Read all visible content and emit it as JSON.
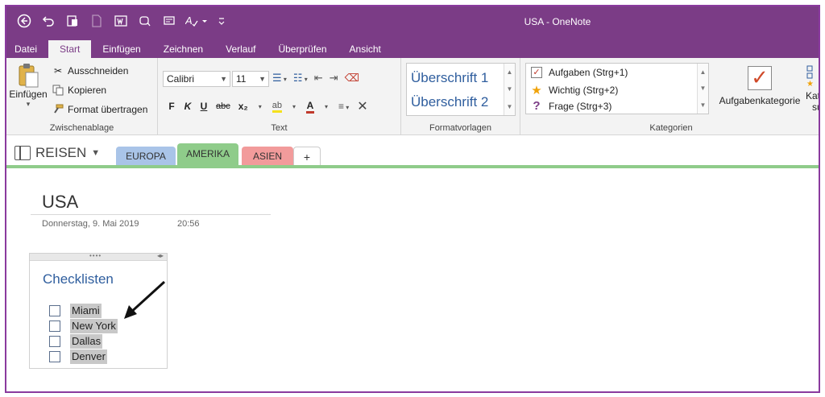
{
  "window": {
    "title": "USA - OneNote"
  },
  "menu": {
    "tabs": [
      "Datei",
      "Start",
      "Einfügen",
      "Zeichnen",
      "Verlauf",
      "Überprüfen",
      "Ansicht"
    ]
  },
  "ribbon": {
    "clipboard": {
      "paste": "Einfügen",
      "cut": "Ausschneiden",
      "copy": "Kopieren",
      "format_painter": "Format übertragen",
      "label": "Zwischenablage"
    },
    "text": {
      "font": "Calibri",
      "size": "11",
      "bold": "F",
      "italic": "K",
      "underline": "U",
      "strike": "abc",
      "subscript": "x₂",
      "font_color": "A",
      "label": "Text"
    },
    "styles": {
      "items": [
        "Überschrift 1",
        "Überschrift 2"
      ],
      "label": "Formatvorlagen"
    },
    "tags": {
      "items": [
        "Aufgaben (Strg+1)",
        "Wichtig (Strg+2)",
        "Frage (Strg+3)"
      ],
      "task_tag": "Aufgabenkategorie",
      "find_tags_partial": "Kateg",
      "find_tags_partial2": "suc",
      "label": "Kategorien"
    }
  },
  "notebook": {
    "name": "REISEN",
    "sections": [
      {
        "label": "EUROPA",
        "color": "#a9c4e8"
      },
      {
        "label": "AMERIKA",
        "color": "#8fcc8a"
      },
      {
        "label": "ASIEN",
        "color": "#f29b9b"
      },
      {
        "label": "+",
        "color": "#ffffff"
      }
    ]
  },
  "page": {
    "title": "USA",
    "date": "Donnerstag, 9. Mai 2019",
    "time": "20:56",
    "note": {
      "heading": "Checklisten",
      "todos": [
        "Miami",
        "New York",
        "Dallas",
        "Denver"
      ]
    }
  },
  "colors": {
    "accent": "#7b3c86",
    "heading": "#2f5e9e"
  }
}
